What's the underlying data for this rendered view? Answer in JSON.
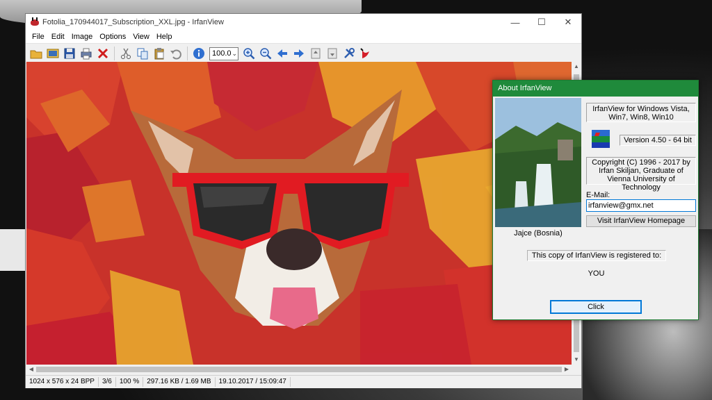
{
  "window": {
    "title": "Fotolia_170944017_Subscription_XXL.jpg - IrfanView",
    "controls": {
      "minimize": "—",
      "maximize": "☐",
      "close": "✕"
    }
  },
  "menu": [
    "File",
    "Edit",
    "Image",
    "Options",
    "View",
    "Help"
  ],
  "toolbar": {
    "zoom_value": "100.0",
    "icons": [
      "open-folder-icon",
      "thumbnails-icon",
      "save-icon",
      "print-icon",
      "delete-icon",
      "cut-icon",
      "copy-icon",
      "paste-icon",
      "undo-icon",
      "info-icon",
      "zoom-in-icon",
      "zoom-out-icon",
      "previous-icon",
      "next-icon",
      "first-page-icon",
      "last-page-icon",
      "settings-icon",
      "exit-icon"
    ]
  },
  "status": {
    "dimensions": "1024 x 576 x 24 BPP",
    "index": "3/6",
    "zoom": "100 %",
    "size": "297.16 KB / 1.69 MB",
    "datetime": "19.10.2017 / 15:09:47"
  },
  "about": {
    "title": "About  IrfanView",
    "photo_caption": "Jajce (Bosnia)",
    "product_line1": "IrfanView for Windows Vista,",
    "product_line2": "Win7, Win8, Win10",
    "version": "Version 4.50 - 64 bit",
    "copyright_line1": "Copyright (C) 1996 - 2017 by",
    "copyright_line2": "Irfan Skiljan, Graduate of",
    "copyright_line3": "Vienna University of Technology",
    "email_label": "E-Mail:",
    "email_value": "irfanview@gmx.net",
    "homepage_button": "Visit IrfanView Homepage",
    "registered_text": "This copy of IrfanView is registered to:",
    "registered_name": "YOU",
    "click_button": "Click"
  },
  "colors": {
    "dialog_title_bg": "#1f8a3b",
    "accent_blue": "#0078d7"
  }
}
